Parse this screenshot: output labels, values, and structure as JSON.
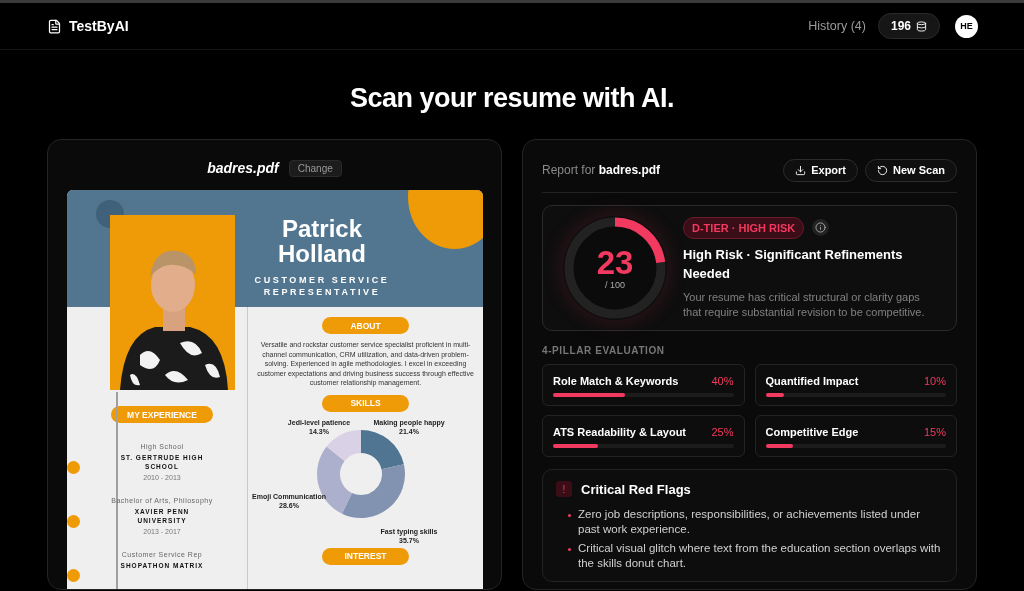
{
  "header": {
    "logo": "TestByAI",
    "history": "History (4)",
    "credits": "196",
    "avatar": "HE"
  },
  "title": "Scan your resume with AI.",
  "preview": {
    "filename": "badres.pdf",
    "change_button": "Change",
    "resume": {
      "name": "Patrick Holland",
      "role": "CUSTOMER SERVICE REPRESENTATIVE",
      "experience_heading": "MY EXPERIENCE",
      "experience": [
        {
          "title": "High School",
          "place": "ST. GERTRUDE HIGH SCHOOL",
          "years": "2010 - 2013"
        },
        {
          "title": "Bachelor of Arts, Philosophy",
          "place": "XAVIER PENN UNIVERSITY",
          "years": "2013 - 2017"
        },
        {
          "title": "Customer Service Rep",
          "place": "SHOPATHON MATRIX"
        }
      ],
      "about_heading": "ABOUT",
      "about": "Versatile and rockstar customer service specialist proficient in multi-channel communication, CRM utilization, and data-driven problem-solving. Experienced in agile methodologies. I excel in exceeding customer expectations and driving business success through effective customer relationship management.",
      "skills_heading": "SKILLS",
      "chart_data": {
        "type": "donut",
        "categories": [
          "Making people happy",
          "Fast typing skills",
          "Emoji Communication",
          "Jedi-level patience"
        ],
        "values": [
          21.4,
          35.7,
          28.6,
          14.3
        ],
        "value_labels": [
          "21.4%",
          "35.7%",
          "28.6%",
          "14.3%"
        ]
      },
      "interest_heading": "INTEREST"
    }
  },
  "report": {
    "heading": "Report for **badres.pdf**",
    "buttons": [
      {
        "kind": "export",
        "label": "Export"
      },
      {
        "kind": "new",
        "label": "New Scan"
      }
    ],
    "score": {
      "value": "23",
      "max": "/ 100",
      "level": 0.23,
      "badge": "D-TIER · HIGH RISK",
      "headline": "High Risk · Significant Refinements Needed",
      "description": "Your resume has critical structural or clarity gaps that require substantial revision to be competitive."
    },
    "pillars_heading": "4-PILLAR EVALUATION",
    "pillars": [
      {
        "name": "Role Match & Keywords",
        "percent": "40%",
        "level": 0.4
      },
      {
        "name": "Quantified Impact",
        "percent": "10%",
        "level": 0.1
      },
      {
        "name": "ATS Readability & Layout",
        "percent": "25%",
        "level": 0.25
      },
      {
        "name": "Competitive Edge",
        "percent": "15%",
        "level": 0.15
      }
    ],
    "red_flags": {
      "icon": "!",
      "title": "Critical Red Flags",
      "items": [
        "Zero job descriptions, responsibilities, or achievements listed under past work experience.",
        "Critical visual glitch where text from the education section overlaps with the skills donut chart."
      ]
    }
  }
}
